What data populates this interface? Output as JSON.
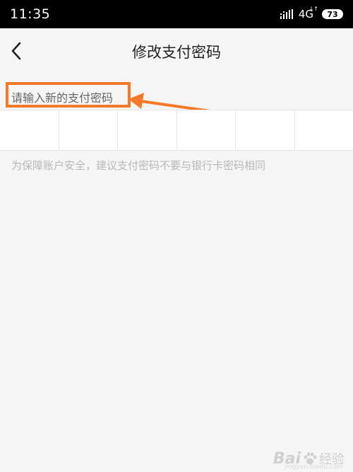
{
  "status_bar": {
    "time": "11:35",
    "network": "4G",
    "network_arrows": "↓↑",
    "battery": "73"
  },
  "header": {
    "back_icon": "chevron-left-icon",
    "title": "修改支付密码"
  },
  "form": {
    "prompt": "请输入新的支付密码",
    "pin_length": 6,
    "hint": "为保障账户安全，建议支付密码不要与银行卡密码相同"
  },
  "annotation": {
    "color": "#f47a2a"
  },
  "watermark": {
    "brand": "Bai",
    "brand_suffix": "经验",
    "url": "jingyan.baidu.com"
  }
}
